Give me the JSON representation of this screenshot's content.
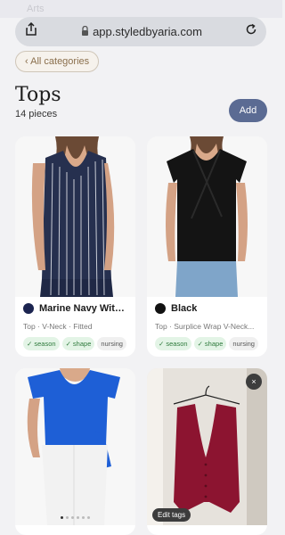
{
  "browser": {
    "ghost_title": "Arts",
    "url": "app.styledbyaria.com"
  },
  "nav": {
    "back_label": "‹ All categories"
  },
  "header": {
    "title": "Tops",
    "count": "14 pieces",
    "add_label": "Add"
  },
  "items": [
    {
      "name": "Marine Navy With ...",
      "swatch_color": "#1b2450",
      "meta": "Top · V-Neck · Fitted",
      "tags": [
        {
          "label": "✓ season",
          "style": "green"
        },
        {
          "label": "✓ shape",
          "style": "green"
        },
        {
          "label": "nursing",
          "style": "gray"
        }
      ]
    },
    {
      "name": "Black",
      "swatch_color": "#111111",
      "meta": "Top · Surplice Wrap V-Neck...",
      "tags": [
        {
          "label": "✓ season",
          "style": "green"
        },
        {
          "label": "✓ shape",
          "style": "green"
        },
        {
          "label": "nursing",
          "style": "gray"
        }
      ]
    },
    {
      "carousel_dots": 6
    },
    {
      "close_label": "×",
      "edit_tags_label": "Edit tags"
    }
  ]
}
